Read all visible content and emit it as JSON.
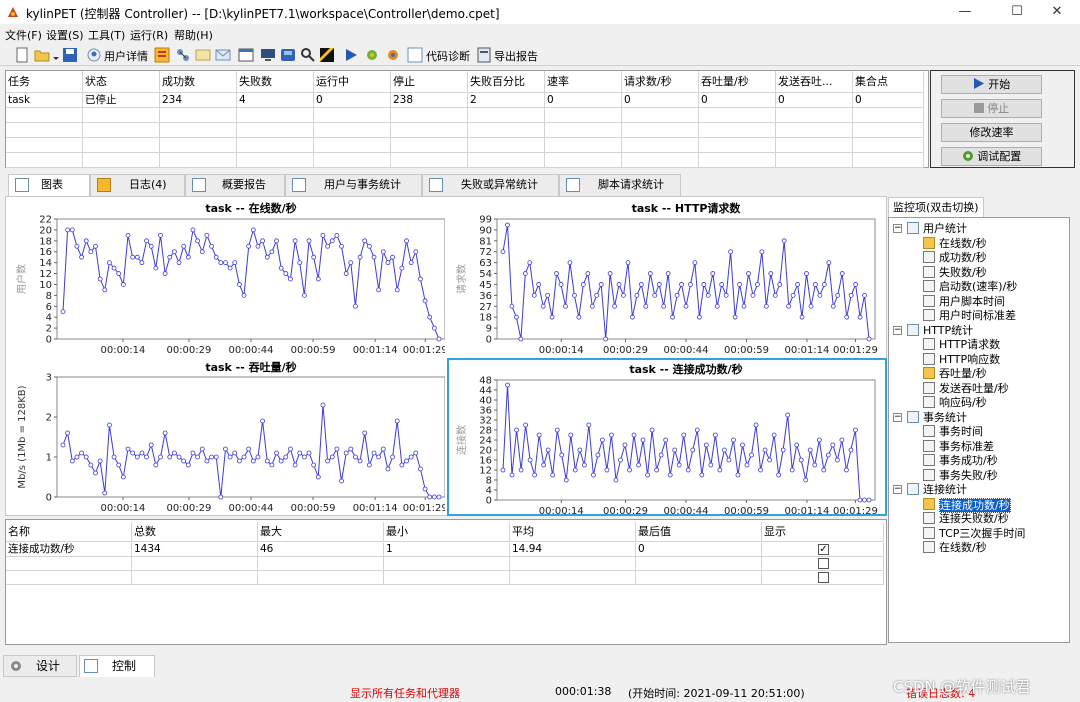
{
  "window": {
    "title": "kylinPET (控制器 Controller) -- [D:\\kylinPET7.1\\workspace\\Controller\\demo.cpet]",
    "minimize": "—",
    "maximize": "☐",
    "close": "✕"
  },
  "menu": [
    "文件(F)",
    "设置(S)",
    "工具(T)",
    "运行(R)",
    "帮助(H)"
  ],
  "toolbar": {
    "user_detail": "用户详情",
    "code_diag": "代码诊断",
    "export_report": "导出报告"
  },
  "task_table": {
    "columns": [
      "任务",
      "状态",
      "成功数",
      "失败数",
      "运行中",
      "停止",
      "失败百分比",
      "速率",
      "请求数/秒",
      "吞吐量/秒",
      "发送吞吐...",
      "集合点"
    ],
    "rows": [
      [
        "task",
        "已停止",
        "234",
        "4",
        "0",
        "238",
        "2",
        "0",
        "0",
        "0",
        "0",
        "0"
      ]
    ]
  },
  "controls": {
    "start": "开始",
    "stop": "停止",
    "modify_rate": "修改速率",
    "debug_config": "调试配置"
  },
  "tabs": [
    "图表",
    "日志(4)",
    "概要报告",
    "用户与事务统计",
    "失败或异常统计",
    "脚本请求统计"
  ],
  "charts": {
    "tl_title": "task -- 在线数/秒",
    "tr_title": "task -- HTTP请求数",
    "bl_title": "task -- 吞吐量/秒",
    "br_title": "task -- 连接成功数/秒",
    "tl_ylabel": "用户数",
    "tr_ylabel": "请求数",
    "bl_ylabel": "Mb/s (1Mb = 128KB)",
    "br_ylabel": "连接数",
    "x_ticks": [
      "00:00:14",
      "00:00:29",
      "00:00:44",
      "00:00:59",
      "00:01:14",
      "00:01:29"
    ]
  },
  "chart_data": [
    {
      "type": "line",
      "title": "task -- 在线数/秒",
      "ylabel": "用户数",
      "ylim": [
        0,
        22
      ],
      "yticks": [
        0,
        2,
        4,
        6,
        8,
        10,
        12,
        14,
        16,
        18,
        20,
        22
      ],
      "x": [
        "00:00:14",
        "00:00:29",
        "00:00:44",
        "00:00:59",
        "00:01:14",
        "00:01:29"
      ],
      "values": [
        5,
        20,
        20,
        17,
        15,
        18,
        16,
        17,
        11,
        9,
        14,
        13,
        12,
        10,
        19,
        15,
        15,
        14,
        18,
        17,
        13,
        19,
        12,
        15,
        16,
        14,
        17,
        15,
        20,
        18,
        16,
        19,
        17,
        15,
        14,
        14,
        13,
        14,
        10,
        8,
        17,
        20,
        17,
        18,
        15,
        16,
        18,
        13,
        12,
        11,
        18,
        14,
        8,
        18,
        15,
        11,
        19,
        17,
        18,
        19,
        17,
        12,
        14,
        6,
        15,
        18,
        17,
        15,
        9,
        16,
        14,
        15,
        9,
        13,
        18,
        14,
        16,
        11,
        7,
        4,
        2,
        0
      ]
    },
    {
      "type": "line",
      "title": "task -- HTTP请求数",
      "ylabel": "请求数",
      "ylim": [
        0,
        99
      ],
      "yticks": [
        0,
        9,
        18,
        27,
        36,
        45,
        54,
        63,
        72,
        81,
        90,
        99
      ],
      "x": [
        "00:00:14",
        "00:00:29",
        "00:00:44",
        "00:00:59",
        "00:01:14",
        "00:01:29"
      ],
      "values": [
        72,
        94,
        27,
        18,
        0,
        54,
        63,
        36,
        45,
        27,
        36,
        18,
        54,
        45,
        27,
        63,
        36,
        18,
        45,
        54,
        27,
        36,
        45,
        0,
        54,
        27,
        45,
        36,
        63,
        18,
        36,
        45,
        27,
        54,
        36,
        45,
        27,
        54,
        18,
        36,
        45,
        27,
        45,
        63,
        18,
        45,
        36,
        54,
        27,
        45,
        36,
        72,
        18,
        45,
        27,
        54,
        36,
        45,
        72,
        27,
        54,
        36,
        45,
        81,
        27,
        36,
        45,
        18,
        54,
        27,
        45,
        36,
        45,
        63,
        27,
        36,
        54,
        18,
        36,
        45,
        18,
        36,
        0
      ]
    },
    {
      "type": "line",
      "title": "task -- 吞吐量/秒",
      "ylabel": "Mb/s (1Mb = 128KB)",
      "ylim": [
        0,
        3
      ],
      "yticks": [
        0,
        1,
        2,
        3
      ],
      "x": [
        "00:00:14",
        "00:00:29",
        "00:00:44",
        "00:00:59",
        "00:01:14",
        "00:01:29"
      ],
      "values": [
        1.3,
        1.6,
        0.9,
        1.0,
        1.1,
        1.0,
        0.8,
        0.6,
        0.9,
        0.1,
        1.8,
        1.0,
        0.8,
        0.5,
        1.2,
        1.1,
        1.0,
        1.1,
        1.0,
        1.3,
        0.8,
        1.0,
        1.6,
        1.0,
        1.1,
        1.0,
        0.9,
        0.8,
        1.1,
        1.0,
        1.2,
        0.9,
        1.0,
        1.0,
        0.0,
        1.2,
        1.0,
        1.1,
        0.9,
        1.0,
        1.2,
        0.9,
        1.0,
        1.9,
        0.9,
        0.8,
        1.1,
        0.9,
        1.0,
        1.2,
        0.8,
        1.1,
        1.0,
        1.1,
        0.8,
        0.5,
        2.3,
        0.9,
        1.0,
        1.2,
        0.4,
        1.1,
        1.2,
        1.0,
        0.9,
        1.6,
        0.8,
        1.1,
        1.0,
        1.2,
        0.7,
        1.0,
        1.9,
        0.8,
        0.9,
        1.0,
        1.1,
        0.7,
        0.2,
        0.0,
        0.0,
        0.0
      ]
    },
    {
      "type": "line",
      "title": "task -- 连接成功数/秒",
      "ylabel": "连接数",
      "ylim": [
        0,
        48
      ],
      "yticks": [
        0,
        4,
        8,
        12,
        16,
        20,
        24,
        28,
        32,
        36,
        40,
        44,
        48
      ],
      "x": [
        "00:00:14",
        "00:00:29",
        "00:00:44",
        "00:00:59",
        "00:01:14",
        "00:01:29"
      ],
      "values": [
        12,
        46,
        10,
        28,
        12,
        30,
        16,
        10,
        26,
        14,
        20,
        10,
        28,
        18,
        8,
        26,
        12,
        20,
        14,
        30,
        10,
        18,
        24,
        12,
        26,
        8,
        16,
        22,
        12,
        26,
        14,
        24,
        10,
        28,
        12,
        18,
        24,
        10,
        20,
        14,
        26,
        12,
        20,
        28,
        10,
        22,
        14,
        26,
        12,
        20,
        16,
        24,
        10,
        22,
        14,
        18,
        30,
        12,
        20,
        16,
        26,
        10,
        20,
        34,
        12,
        22,
        16,
        8,
        20,
        14,
        24,
        12,
        18,
        22,
        16,
        24,
        12,
        20,
        28,
        0,
        0,
        0
      ]
    }
  ],
  "stat_table": {
    "columns": [
      "名称",
      "总数",
      "最大",
      "最小",
      "平均",
      "最后值",
      "显示"
    ],
    "rows": [
      [
        "连接成功数/秒",
        "1434",
        "46",
        "1",
        "14.94",
        "0",
        "✓"
      ],
      [
        "",
        "",
        "",
        "",
        "",
        "",
        ""
      ],
      [
        "",
        "",
        "",
        "",
        "",
        "",
        ""
      ]
    ]
  },
  "monitor": {
    "label": "监控项(双击切换)",
    "groups": [
      {
        "name": "用户统计",
        "items": [
          "在线数/秒",
          "成功数/秒",
          "失败数/秒",
          "启动数(速率)/秒",
          "用户脚本时间",
          "用户时间标准差"
        ]
      },
      {
        "name": "HTTP统计",
        "items": [
          "HTTP请求数",
          "HTTP响应数",
          "吞吐量/秒",
          "发送吞吐量/秒",
          "响应码/秒"
        ]
      },
      {
        "name": "事务统计",
        "items": [
          "事务时间",
          "事务标准差",
          "事务成功/秒",
          "事务失败/秒"
        ]
      },
      {
        "name": "连接统计",
        "items": [
          "连接成功数/秒",
          "连接失败数/秒",
          "TCP三次握手时间",
          "在线数/秒"
        ]
      }
    ]
  },
  "bottom_tabs": [
    "设计",
    "控制"
  ],
  "status": {
    "show_all": "显示所有任务和代理器",
    "elapsed": "000:01:38",
    "start_time": "(开始时间: 2021-09-11 20:51:00)",
    "error_log": "错误日志数: 4",
    "watermark": "CSDN @软件测试君"
  },
  "colors": {
    "line": "#3a3adc",
    "selected_border": "#2fa3dc",
    "status_red": "#e00000",
    "tree_selected": "#0a5ecf"
  }
}
